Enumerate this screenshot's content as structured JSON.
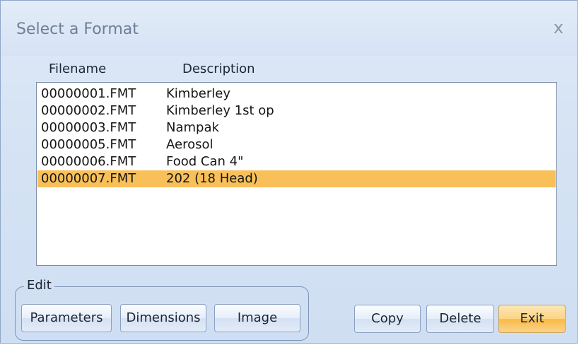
{
  "dialog": {
    "title": "Select a Format",
    "close_label": "x"
  },
  "columns": {
    "filename": "Filename",
    "description": "Description"
  },
  "formats": [
    {
      "filename": "00000001.FMT",
      "description": "Kimberley",
      "selected": false
    },
    {
      "filename": "00000002.FMT",
      "description": "Kimberley 1st op",
      "selected": false
    },
    {
      "filename": "00000003.FMT",
      "description": "Nampak",
      "selected": false
    },
    {
      "filename": "00000005.FMT",
      "description": "Aerosol",
      "selected": false
    },
    {
      "filename": "00000006.FMT",
      "description": "Food Can 4\"",
      "selected": false
    },
    {
      "filename": "00000007.FMT",
      "description": "202 (18 Head)",
      "selected": true
    }
  ],
  "edit_group": {
    "label": "Edit",
    "parameters_label": "Parameters",
    "dimensions_label": "Dimensions",
    "image_label": "Image"
  },
  "actions": {
    "copy_label": "Copy",
    "delete_label": "Delete",
    "exit_label": "Exit"
  },
  "colors": {
    "selection": "#f9c05a",
    "exit_button": "#f9b947"
  }
}
